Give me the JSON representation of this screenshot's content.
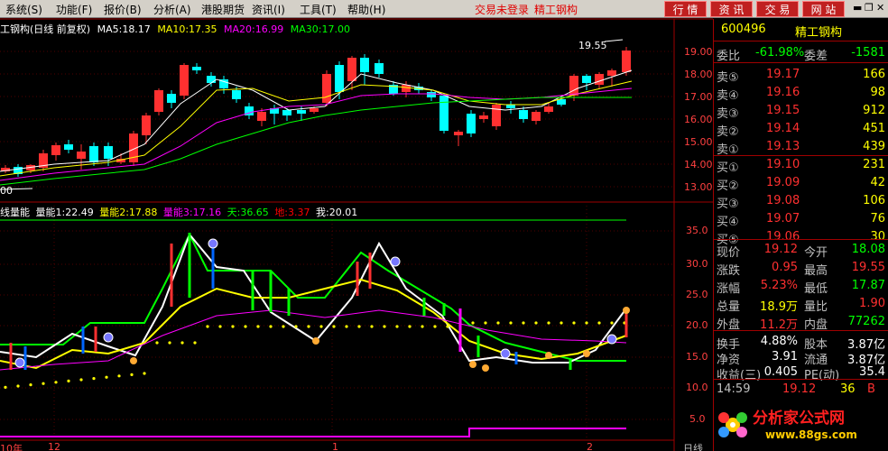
{
  "menubar": {
    "items": [
      "系统(S)",
      "功能(F)",
      "报价(B)",
      "分析(A)",
      "港股期货",
      "资讯(I)",
      "工具(T)",
      "帮助(H)"
    ],
    "status": "交易未登录",
    "stock_name": "精工钢构",
    "buttons": [
      "行 情",
      "资 讯",
      "交 易",
      "网 站"
    ]
  },
  "main_chart": {
    "title": "工钢构(日线 前复权)",
    "ma_labels": [
      {
        "text": "MA5:18.17",
        "color": "#ffffff"
      },
      {
        "text": "MA10:17.35",
        "color": "#ffff00"
      },
      {
        "text": "MA20:16.99",
        "color": "#ff00ff"
      },
      {
        "text": "MA30:17.00",
        "color": "#00ff00"
      }
    ],
    "y_ticks": [
      "19.00",
      "18.00",
      "17.00",
      "16.00",
      "15.00",
      "14.00",
      "13.00"
    ],
    "high_label": "19.55",
    "low_label": "00"
  },
  "sub_chart": {
    "title": "线量能",
    "labels": [
      {
        "text": "量能1:22.49",
        "color": "#ffffff"
      },
      {
        "text": "量能2:17.88",
        "color": "#ffff00"
      },
      {
        "text": "量能3:17.16",
        "color": "#ff00ff"
      },
      {
        "text": "天:36.65",
        "color": "#00ff00"
      },
      {
        "text": "地:3.37",
        "color": "#ff0000"
      },
      {
        "text": "我:20.01",
        "color": "#ffffff"
      }
    ],
    "y_ticks": [
      "35.0",
      "30.0",
      "25.0",
      "20.0",
      "15.0",
      "10.0",
      "5.0"
    ],
    "x_labels": [
      "10年",
      "12",
      "1",
      "2"
    ],
    "period": "日线"
  },
  "quote_panel": {
    "code": "600496",
    "name": "精工钢构",
    "wei_bi_label": "委比",
    "wei_bi": "-61.98%",
    "wei_cha_label": "委差",
    "wei_cha": "-1581",
    "sells": [
      {
        "label": "卖⑤",
        "price": "19.17",
        "vol": "166"
      },
      {
        "label": "卖④",
        "price": "19.16",
        "vol": "98"
      },
      {
        "label": "卖③",
        "price": "19.15",
        "vol": "912"
      },
      {
        "label": "卖②",
        "price": "19.14",
        "vol": "451"
      },
      {
        "label": "卖①",
        "price": "19.13",
        "vol": "439"
      }
    ],
    "buys": [
      {
        "label": "买①",
        "price": "19.10",
        "vol": "231"
      },
      {
        "label": "买②",
        "price": "19.09",
        "vol": "42"
      },
      {
        "label": "买③",
        "price": "19.08",
        "vol": "106"
      },
      {
        "label": "买④",
        "price": "19.07",
        "vol": "76"
      },
      {
        "label": "买⑤",
        "price": "19.06",
        "vol": "30"
      }
    ],
    "stats": [
      {
        "l1": "现价",
        "v1": "19.12",
        "c1": "#ff3030",
        "l2": "今开",
        "v2": "18.08",
        "c2": "#00ff00"
      },
      {
        "l1": "涨跌",
        "v1": "0.95",
        "c1": "#ff3030",
        "l2": "最高",
        "v2": "19.55",
        "c2": "#ff3030"
      },
      {
        "l1": "涨幅",
        "v1": "5.23%",
        "c1": "#ff3030",
        "l2": "最低",
        "v2": "17.87",
        "c2": "#00ff00"
      },
      {
        "l1": "总量",
        "v1": "18.9万",
        "c1": "#ffff00",
        "l2": "量比",
        "v2": "1.90",
        "c2": "#ff3030"
      },
      {
        "l1": "外盘",
        "v1": "11.2万",
        "c1": "#ff3030",
        "l2": "内盘",
        "v2": "77262",
        "c2": "#00ff00"
      }
    ],
    "stats2": [
      {
        "l1": "换手",
        "v1": "4.88%",
        "l2": "股本",
        "v2": "3.87亿"
      },
      {
        "l1": "净资",
        "v1": "3.91",
        "l2": "流通",
        "v2": "3.87亿"
      },
      {
        "l1": "收益(三)",
        "v1": "0.405",
        "l2": "PE(动)",
        "v2": "35.4"
      }
    ],
    "tick": {
      "time": "14:59",
      "price": "19.12",
      "vol": "36",
      "side": "B"
    }
  },
  "logo": {
    "text": "分析家公式网",
    "url": "www.88gs.com"
  },
  "colors": {
    "up": "#ff3030",
    "down": "#00ffff",
    "grid": "#a00000",
    "green": "#00ff00"
  }
}
